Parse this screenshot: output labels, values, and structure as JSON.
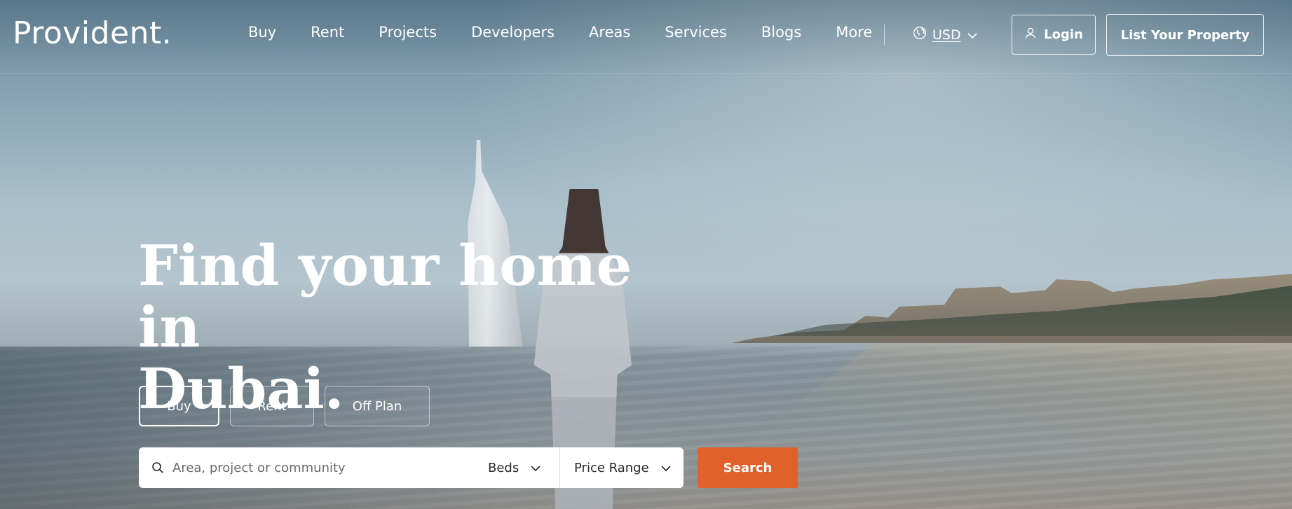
{
  "brand": {
    "logo_text": "Provident."
  },
  "nav": {
    "items": [
      {
        "label": "Buy"
      },
      {
        "label": "Rent"
      },
      {
        "label": "Projects"
      },
      {
        "label": "Developers"
      },
      {
        "label": "Areas"
      },
      {
        "label": "Services"
      },
      {
        "label": "Blogs"
      },
      {
        "label": "More"
      }
    ]
  },
  "currency": {
    "selected": "USD",
    "icon": "globe-icon"
  },
  "auth": {
    "login_label": "Login",
    "login_icon": "user-icon"
  },
  "cta": {
    "list_property_label": "List Your Property"
  },
  "hero": {
    "headline_line1": "Find your home in",
    "headline_line2": "Dubai."
  },
  "search": {
    "tabs": [
      {
        "label": "Buy",
        "active": true
      },
      {
        "label": "Rent",
        "active": false
      },
      {
        "label": "Off Plan",
        "active": false
      }
    ],
    "placeholder": "Area, project or community",
    "beds_label": "Beds",
    "price_label": "Price Range",
    "submit_label": "Search"
  },
  "colors": {
    "accent": "#e0622a",
    "text_on_hero": "#ffffff",
    "search_bg": "#ffffff"
  }
}
